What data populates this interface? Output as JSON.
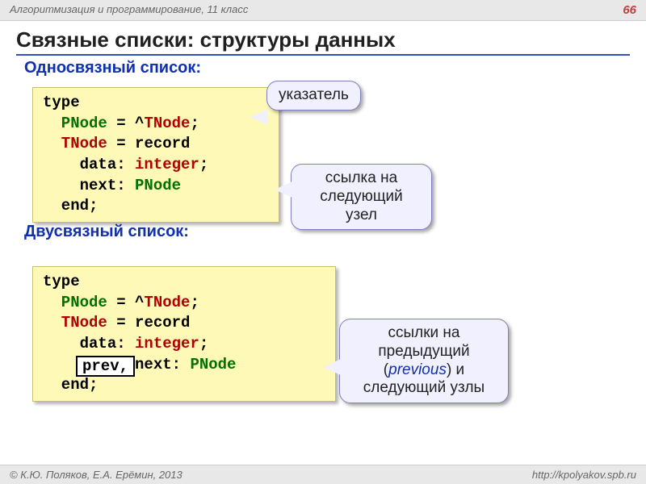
{
  "header": {
    "course": "Алгоритмизация и программирование, 11 класс",
    "page": "66"
  },
  "title": "Связные списки: структуры данных",
  "sections": {
    "single": {
      "heading": "Односвязный список:",
      "code": {
        "l1": "type",
        "l2a": "  PNode",
        "l2b": " = ^",
        "l2c": "TNode",
        "l2d": ";",
        "l3a": "  TNode",
        "l3b": " = ",
        "l3c": "record",
        "l4a": "    data: ",
        "l4b": "integer",
        "l4c": ";",
        "l5a": "    next: ",
        "l5b": "PNode",
        "l6": "  end;"
      }
    },
    "double": {
      "heading": "Двусвязный список:",
      "code": {
        "l1": "type",
        "l2a": "  PNode",
        "l2b": " = ^",
        "l2c": "TNode",
        "l2d": ";",
        "l3a": "  TNode",
        "l3b": " = ",
        "l3c": "record",
        "l4a": "    data: ",
        "l4b": "integer",
        "l4c": ";",
        "l5a": "          next: ",
        "l5b": "PNode",
        "l6": "  end;"
      },
      "prev_label": "prev,"
    }
  },
  "bubbles": {
    "pointer": "указатель",
    "next_link": "ссылка на следующий узел",
    "prev_next_1": "ссылки на предыдущий (",
    "prev_next_italic": "previous",
    "prev_next_2": ") и следующий узлы"
  },
  "footer": {
    "copyright": "© К.Ю. Поляков, Е.А. Ерёмин, 2013",
    "url": "http://kpolyakov.spb.ru"
  }
}
